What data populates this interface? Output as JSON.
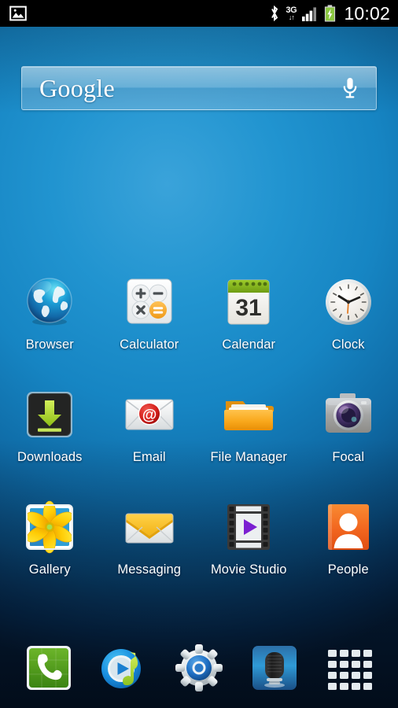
{
  "statusbar": {
    "left_icons": [
      {
        "name": "screenshot-image-icon",
        "glyph": "image"
      }
    ],
    "bluetooth": {
      "name": "bluetooth-icon",
      "label": "Bluetooth"
    },
    "network": {
      "name": "network-3g-icon",
      "label": "3G",
      "arrows": "↓↑"
    },
    "signal": {
      "name": "signal-bars-icon",
      "bars": 4,
      "active_bars": 3
    },
    "battery": {
      "name": "battery-charging-icon",
      "charging": true,
      "color": "#8ac63f"
    },
    "time": "10:02"
  },
  "search": {
    "name": "google-search-bar",
    "brand": "Google",
    "placeholder": "Google",
    "value": "",
    "mic_label": "Voice search"
  },
  "apps": [
    {
      "id": "browser",
      "label": "Browser",
      "icon": "browser-globe-icon"
    },
    {
      "id": "calculator",
      "label": "Calculator",
      "icon": "calculator-icon"
    },
    {
      "id": "calendar",
      "label": "Calendar",
      "icon": "calendar-icon",
      "day": "31"
    },
    {
      "id": "clock",
      "label": "Clock",
      "icon": "clock-icon"
    },
    {
      "id": "downloads",
      "label": "Downloads",
      "icon": "downloads-arrow-icon"
    },
    {
      "id": "email",
      "label": "Email",
      "icon": "email-envelope-icon",
      "badge": "@"
    },
    {
      "id": "filemanager",
      "label": "File Manager",
      "icon": "folder-icon"
    },
    {
      "id": "focal",
      "label": "Focal",
      "icon": "camera-icon"
    },
    {
      "id": "gallery",
      "label": "Gallery",
      "icon": "gallery-photo-icon"
    },
    {
      "id": "messaging",
      "label": "Messaging",
      "icon": "messaging-envelope-icon"
    },
    {
      "id": "moviestudio",
      "label": "Movie Studio",
      "icon": "film-strip-play-icon"
    },
    {
      "id": "people",
      "label": "People",
      "icon": "people-contact-icon"
    }
  ],
  "dock": [
    {
      "id": "phone",
      "label": "Phone",
      "icon": "phone-handset-icon"
    },
    {
      "id": "music",
      "label": "Music",
      "icon": "music-play-note-icon"
    },
    {
      "id": "settings",
      "label": "Settings",
      "icon": "gear-icon"
    },
    {
      "id": "recorder",
      "label": "Sound Recorder",
      "icon": "microphone-icon"
    },
    {
      "id": "drawer",
      "label": "Apps",
      "icon": "app-drawer-grid-icon"
    }
  ],
  "colors": {
    "wallpaper_top": "#1b8ccb",
    "wallpaper_bottom": "#04162a",
    "statusbar": "#000000",
    "label_text": "#ffffff",
    "battery_green": "#8ac63f",
    "calc_orange": "#f0a030",
    "folder_orange": "#f5a623",
    "people_orange": "#f0622a",
    "play_purple": "#7b1fd1",
    "phone_green": "#4b9b1e"
  }
}
